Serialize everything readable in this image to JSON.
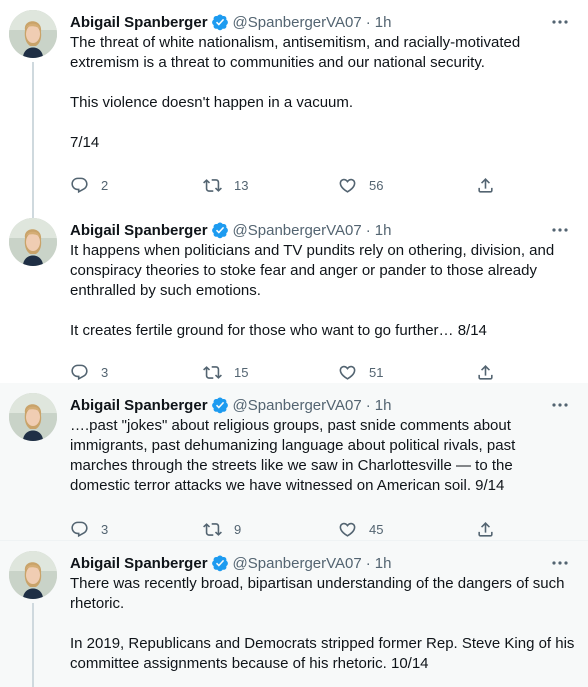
{
  "tweets": [
    {
      "name": "Abigail Spanberger",
      "handle": "@SpanbergerVA07",
      "dot": "·",
      "time": "1h",
      "text": "The threat of white nationalism, antisemitism, and racially-motivated extremism is a threat to communities and our national security.\n\nThis violence doesn't happen in a vacuum.\n\n7/14",
      "replies": "2",
      "retweets": "13",
      "likes": "56"
    },
    {
      "name": "Abigail Spanberger",
      "handle": "@SpanbergerVA07",
      "dot": "·",
      "time": "1h",
      "text": "It happens when politicians and TV pundits rely on othering, division, and conspiracy theories to stoke fear and anger or pander to those already enthralled by such emotions.\n\nIt creates fertile ground for those who want to go further… 8/14",
      "replies": "3",
      "retweets": "15",
      "likes": "51"
    },
    {
      "name": "Abigail Spanberger",
      "handle": "@SpanbergerVA07",
      "dot": "·",
      "time": "1h",
      "text": "….past \"jokes\" about religious groups, past snide comments about immigrants, past dehumanizing language about political rivals, past marches through the streets like we saw in Charlottesville — to the domestic terror attacks we have witnessed on American soil. 9/14",
      "replies": "3",
      "retweets": "9",
      "likes": "45"
    },
    {
      "name": "Abigail Spanberger",
      "handle": "@SpanbergerVA07",
      "dot": "·",
      "time": "1h",
      "text": "There was recently broad, bipartisan understanding of the dangers of such rhetoric.\n\nIn 2019, Republicans and Democrats stripped former Rep. Steve King of his committee assignments because of his rhetoric. 10/14"
    }
  ],
  "icons": {
    "verified": "verified-badge-icon",
    "more": "more-icon",
    "reply": "reply-icon",
    "retweet": "retweet-icon",
    "like": "like-icon",
    "share": "share-icon"
  },
  "colors": {
    "verified": "#1d9bf0",
    "muted": "#536471",
    "text": "#0f1419",
    "thread_line": "#cfd9de",
    "shaded_bg": "#f7f9f9"
  }
}
